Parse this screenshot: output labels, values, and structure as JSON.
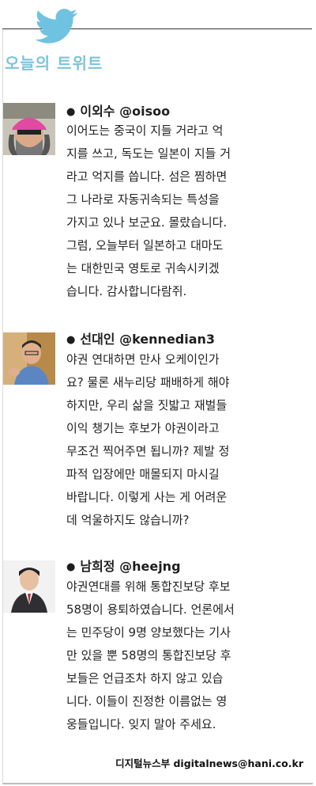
{
  "section": {
    "title": "오늘의 트위트"
  },
  "tweets": [
    {
      "author": "이외수",
      "handle": "@oisoo",
      "lines": [
        "이어도는 중국이 지들 거라고 억",
        "지를 쓰고, 독도는 일본이 지들 거",
        "라고 억지를 씁니다. 섬은 찜하면",
        "그 나라로 자동귀속되는 특성을",
        "가지고 있나 보군요. 몰랐습니다.",
        "그럼, 오늘부터 일본하고 대마도",
        "는 대한민국 영토로 귀속시키겠",
        "습니다. 감사합니다람쥐."
      ]
    },
    {
      "author": "선대인",
      "handle": "@kennedian3",
      "lines": [
        "야권 연대하면 만사 오케이인가",
        "요? 물론 새누리당 패배하게 해야",
        "하지만, 우리 삶을 짓밟고 재벌들",
        "이익 챙기는 후보가 야권이라고",
        "무조건 찍어주면 됩니까? 제발 정",
        "파적 입장에만 매몰되지 마시길",
        "바랍니다. 이렇게 사는 게 어려운",
        "데 억울하지도 않습니까?"
      ]
    },
    {
      "author": "남희정",
      "handle": "@heejng",
      "lines": [
        "야권연대를 위해 통합진보당 후보",
        "58명이 용퇴하였습니다. 언론에서",
        "는 민주당이 9명 양보했다는 기사",
        "만 있을 뿐 58명의 통합진보당 후",
        "보들은 언급조차 하지 않고 있습",
        "니다. 이들이 진정한 이름없는 영",
        "웅들입니다. 잊지 말아 주세요."
      ]
    }
  ],
  "footer": {
    "credit": "디지털뉴스부 digitalnews@hani.co.kr"
  },
  "colors": {
    "accent": "#7ec4d9",
    "text": "#222222"
  }
}
